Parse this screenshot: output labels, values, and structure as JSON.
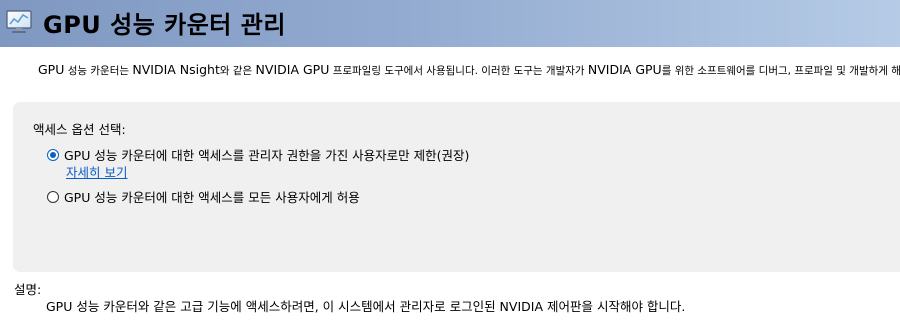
{
  "header": {
    "title": "GPU 성능 카운터 관리",
    "icon": "monitor-icon"
  },
  "intro": {
    "part1": "GPU",
    "part2": " 성능 카운터는 ",
    "part3": "NVIDIA Nsight",
    "part4": "와 같은 ",
    "part5": "NVIDIA GPU",
    "part6": " 프로파일링 도구에서 사용됩니다. 이러한 도구는 개발자가 ",
    "part7": "NVIDIA GPU",
    "part8": "를 위한 소프트웨어를 디버그, 프로파일 및 개발하게 해줍니다."
  },
  "access": {
    "label": "액세스 옵션 선택:",
    "options": [
      {
        "label": "GPU 성능 카운터에 대한 액세스를 관리자 권한을 가진 사용자로만 제한(권장)",
        "checked": true
      },
      {
        "label": "GPU 성능 카운터에 대한 액세스를 모든 사용자에게 허용",
        "checked": false
      }
    ],
    "details_link": "자세히 보기"
  },
  "description": {
    "label": "설명:",
    "text": "GPU 성능 카운터와 같은 고급 기능에 액세스하려면, 이 시스템에서 관리자로 로그인된 NVIDIA 제어판을 시작해야 합니다."
  },
  "colors": {
    "header_start": "#7f98c1",
    "header_end": "#b5cbe6",
    "panel_bg": "#f0f0f0",
    "accent": "#0b5dc7"
  }
}
